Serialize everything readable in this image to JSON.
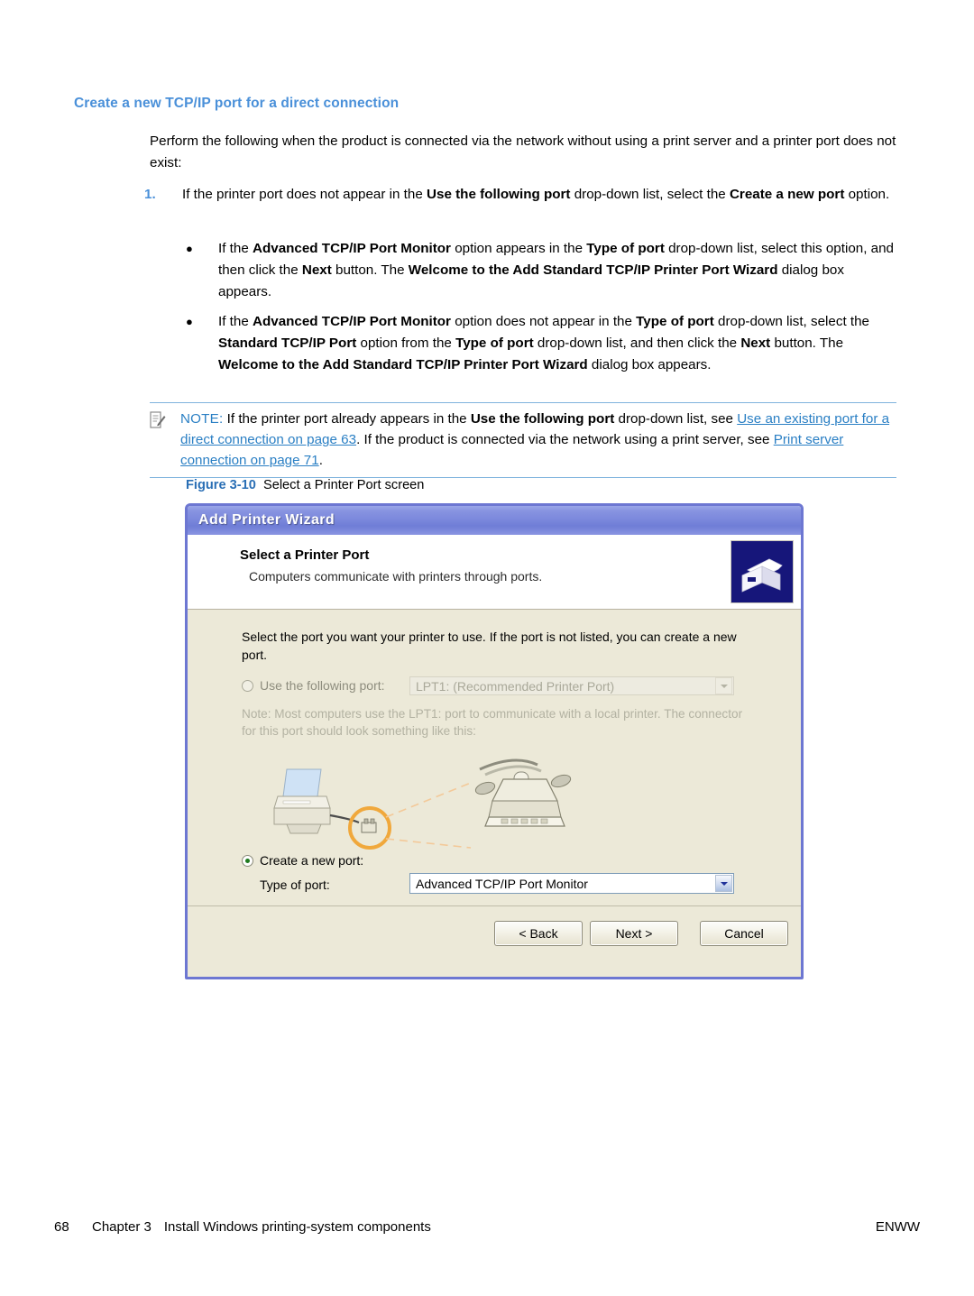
{
  "document": {
    "section_heading": "Create a new TCP/IP port for a direct connection",
    "intro_paragraph": "Perform the following when the product is connected via the network without using a print server and a printer port does not exist:",
    "numbered_items": [
      {
        "number": "1.",
        "text_parts": [
          {
            "t": "If the printer port does not appear in the ",
            "bold": false
          },
          {
            "t": "Use the following port",
            "bold": true
          },
          {
            "t": " drop-down list, select the ",
            "bold": false
          },
          {
            "t": "Create a new port",
            "bold": true
          },
          {
            "t": " option.",
            "bold": false
          }
        ]
      }
    ],
    "bullets": [
      {
        "marker": "●",
        "text_parts": [
          {
            "t": "If the ",
            "bold": false
          },
          {
            "t": "Advanced TCP/IP Port Monitor",
            "bold": true
          },
          {
            "t": " option appears in the ",
            "bold": false
          },
          {
            "t": "Type of port",
            "bold": true
          },
          {
            "t": " drop-down list, select this option, and then click the ",
            "bold": false
          },
          {
            "t": "Next",
            "bold": true
          },
          {
            "t": " button. The ",
            "bold": false
          },
          {
            "t": "Welcome to the Add Standard TCP/IP Printer Port Wizard",
            "bold": true
          },
          {
            "t": " dialog box appears.",
            "bold": false
          }
        ]
      },
      {
        "marker": "●",
        "text_parts": [
          {
            "t": "If the ",
            "bold": false
          },
          {
            "t": "Advanced TCP/IP Port Monitor",
            "bold": true
          },
          {
            "t": " option does not appear in the ",
            "bold": false
          },
          {
            "t": "Type of port",
            "bold": true
          },
          {
            "t": " drop-down list, select the ",
            "bold": false
          },
          {
            "t": "Standard TCP/IP Port",
            "bold": true
          },
          {
            "t": " option from the ",
            "bold": false
          },
          {
            "t": "Type of port",
            "bold": true
          },
          {
            "t": " drop-down list, and then click the ",
            "bold": false
          },
          {
            "t": "Next",
            "bold": true
          },
          {
            "t": " button. The ",
            "bold": false
          },
          {
            "t": "Welcome to the Add Standard TCP/IP Printer Port Wizard",
            "bold": true
          },
          {
            "t": " dialog box appears.",
            "bold": false
          }
        ]
      }
    ],
    "note": {
      "label": "NOTE:",
      "icon": "note-pencil-icon",
      "text_parts": [
        {
          "t": "If the printer port already appears in the ",
          "style": "normal"
        },
        {
          "t": "Use the following port",
          "style": "bold"
        },
        {
          "t": " drop-down list, see ",
          "style": "normal"
        },
        {
          "t": "Use an existing port for a direct connection on page 63",
          "style": "link"
        },
        {
          "t": ". If the product is connected via the network using a print server, see ",
          "style": "normal"
        },
        {
          "t": "Print server connection on page 71",
          "style": "link"
        },
        {
          "t": ".",
          "style": "normal"
        }
      ]
    },
    "figure": {
      "label": "Figure 3-10",
      "title": "Select a Printer Port screen"
    },
    "footer": {
      "page_number": "68",
      "chapter": "Chapter 3",
      "chapter_title": "Install Windows printing-system components",
      "right_label": "ENWW"
    }
  },
  "dialog": {
    "window_title": "Add Printer Wizard",
    "header": {
      "title": "Select a Printer Port",
      "subtitle": "Computers communicate with printers through ports.",
      "icon": "printer-icon"
    },
    "instruction": "Select the port you want your printer to use.  If the port is not listed, you can create a new port.",
    "use_following_port": {
      "radio_label": "Use the following port:",
      "selected": false,
      "enabled": false,
      "combo_value": "LPT1: (Recommended Printer Port)",
      "combo_enabled": false
    },
    "port_note": "Note: Most computers use the LPT1: port to communicate with a local printer. The connector for this port should look something like this:",
    "illustration": "printer-parallel-cable-illustration",
    "create_new_port": {
      "radio_label": "Create a new port:",
      "selected": true,
      "enabled": true,
      "type_label": "Type of port:",
      "combo_value": "Advanced TCP/IP Port Monitor",
      "combo_enabled": true
    },
    "buttons": {
      "back": "< Back",
      "next": "Next >",
      "cancel": "Cancel"
    }
  },
  "colors": {
    "heading_blue": "#4a90d9",
    "link_blue": "#2a7fc4",
    "note_rule_blue": "#7fb3dd",
    "dialog_border": "#6d77d2",
    "dialog_face": "#ece9d8",
    "titlebar_blue": "#7c89dd",
    "icon_navy": "#16167a",
    "radio_dot_green": "#1f7a1f"
  }
}
